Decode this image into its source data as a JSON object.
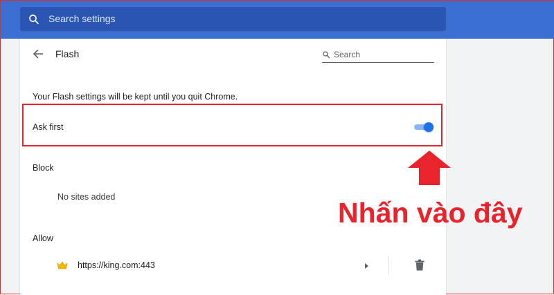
{
  "topbar": {
    "search_placeholder": "Search settings",
    "search_icon": "search-icon"
  },
  "flash": {
    "title": "Flash",
    "back_icon": "arrow-left-icon",
    "search_placeholder": "Search",
    "info_text": "Your Flash settings will be kept until you quit Chrome.",
    "ask_first": {
      "label": "Ask first",
      "enabled": true
    },
    "block": {
      "heading": "Block",
      "empty_text": "No sites added"
    },
    "allow": {
      "heading": "Allow",
      "sites": [
        {
          "url": "https://king.com:443",
          "icon": "crown-icon"
        }
      ]
    }
  },
  "annotation": {
    "text": "Nhấn vào đây",
    "color": "#e8232b"
  },
  "colors": {
    "header": "#3b6fd1",
    "search_box": "#2a55b3",
    "toggle_on": "#1a73e8"
  }
}
